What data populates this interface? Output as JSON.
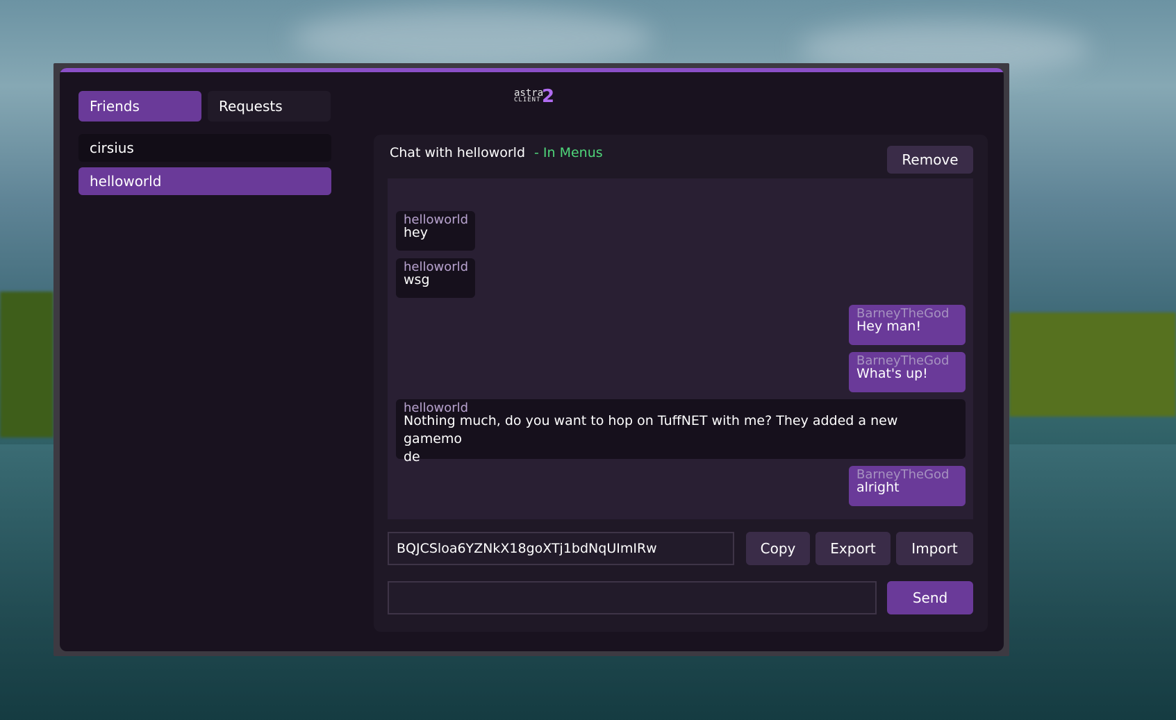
{
  "tabs": {
    "friends": "Friends",
    "requests": "Requests"
  },
  "friends": [
    {
      "name": "cirsius"
    },
    {
      "name": "helloworld"
    }
  ],
  "logo": {
    "line1": "astra",
    "line2": "CLIENT",
    "number": "2"
  },
  "chat": {
    "title": "Chat with helloworld",
    "status": "- In Menus",
    "status_color": "#4fd67a",
    "remove_label": "Remove"
  },
  "messages": [
    {
      "author": "helloworld",
      "text": "hey",
      "direction": "incoming"
    },
    {
      "author": "helloworld",
      "text": "wsg",
      "direction": "incoming"
    },
    {
      "author": "BarneyTheGod",
      "text": "Hey man!",
      "direction": "outgoing"
    },
    {
      "author": "BarneyTheGod",
      "text": "What's up!",
      "direction": "outgoing"
    },
    {
      "author": "helloworld",
      "text": "Nothing much, do you want to hop on TuffNET with me? They added a new gamemo",
      "text_cont": "de",
      "direction": "incoming"
    },
    {
      "author": "BarneyTheGod",
      "text": "alright",
      "direction": "outgoing"
    }
  ],
  "code": {
    "value": "BQJCSloa6YZNkX18goXTj1bdNqUImIRw",
    "copy_label": "Copy",
    "export_label": "Export",
    "import_label": "Import"
  },
  "composer": {
    "value": "",
    "send_label": "Send"
  },
  "colors": {
    "accent": "#8a4fc7",
    "selected": "#6a3a99",
    "panel": "#19121f"
  }
}
